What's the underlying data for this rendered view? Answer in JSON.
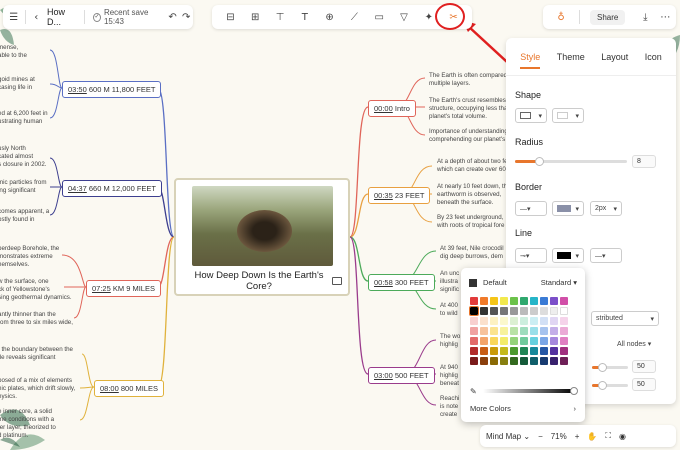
{
  "toolbar": {
    "doc_title": "How D...",
    "save_status": "Recent save 15:43",
    "share_label": "Share"
  },
  "center": {
    "title": "How Deep Down Is the Earth's Core?"
  },
  "left_branches": [
    {
      "time": "03:50",
      "text": "600 M 11,800 FEET",
      "color": "#5a6fc4"
    },
    {
      "time": "04:37",
      "text": "660 M 12,000 FEET",
      "color": "#3d3f8f"
    },
    {
      "time": "07:25",
      "text": "KM 9 MILES",
      "color": "#e0655a"
    },
    {
      "time": "08:00",
      "text": "800 MILES",
      "color": "#e0b23c"
    }
  ],
  "right_branches": [
    {
      "time": "00:00",
      "text": "Intro",
      "color": "#e0655a"
    },
    {
      "time": "00:35",
      "text": "23 FEET",
      "color": "#e8a040"
    },
    {
      "time": "00:58",
      "text": "300 FEET",
      "color": "#4caa5a"
    },
    {
      "time": "03:00",
      "text": "500 FEET",
      "color": "#9a3c8c"
    }
  ],
  "left_leaves": [
    "mense,\nable to the",
    "goid mines at\ncasing life in",
    "ed at 6,200 feet in\nustrating human",
    "usly North\ncated almost\ns closure in 2002.",
    "mic particles from\ning significant",
    "comes apparent, a\nostly found in",
    "perdeep Borehole, the\nmonstrates extreme\nhemselves.",
    "w the surface, one\nck of Yellowstone's\nsing geothermal dynamics.",
    "antly thinner than the\nrom three to six miles wide,",
    ", the boundary between the\ntle reveals significant",
    "posed of a mix of elements\nnic plates, which drift slowly,\nhysics.",
    "e inner core, a solid\nme conditions with a\nter layer, theorized to\nd platinum."
  ],
  "right_leaves": [
    "The Earth is often compared\nmultiple layers.",
    "The Earth's crust resembles a\nstructure, occupying less tha\nplanet's total volume.",
    "Importance of understanding\ncomprehending our planet's",
    "At a depth of about two fe\nwhich can create over 60",
    "At nearly 10 feet down, th\nearthworm is observed,\nbeneath the surface.",
    "By 23 feet underground,\nwith roots of tropical fore",
    "At 39 feet, Nile crocodil\ndig deep burrows, dem",
    "An unc\nillustra\nsignific",
    "At 400\nto wild",
    "The wo\nhighlig",
    "At 940\nhighlig\nbeneat",
    "Reachi\nis note\ncreate"
  ],
  "style_panel": {
    "tabs": [
      "Style",
      "Theme",
      "Layout",
      "Icon"
    ],
    "active_tab": "Style",
    "shape_label": "Shape",
    "radius_label": "Radius",
    "radius_value": "8",
    "border_label": "Border",
    "border_width": "2px",
    "line_label": "Line",
    "distributed_label": "stributed",
    "all_nodes_label": "All nodes",
    "value_a": "50",
    "value_b": "50"
  },
  "color_picker": {
    "default_label": "Default",
    "palette_label": "Standard",
    "more_colors": "More Colors"
  },
  "bottom_bar": {
    "view_mode": "Mind Map",
    "zoom": "71%"
  },
  "colors": {
    "accent": "#e8762c",
    "highlight_ring": "#e02020"
  }
}
